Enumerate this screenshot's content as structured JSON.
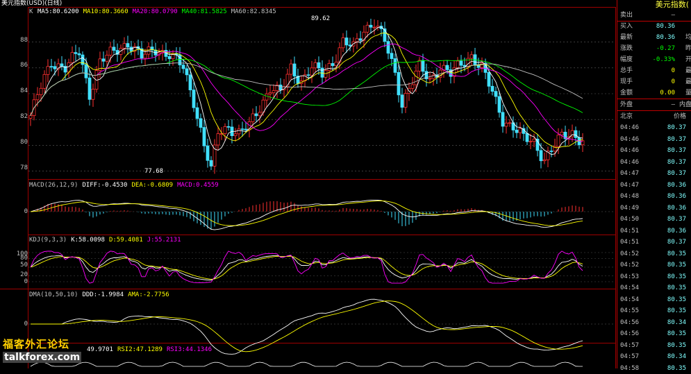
{
  "window_title": "美元指数(USD)(日线)",
  "main": {
    "legend_lead": "K",
    "legend": [
      {
        "label": "MA5:80.6200",
        "color": "#ffffff"
      },
      {
        "label": "MA10:80.3660",
        "color": "#ffff00"
      },
      {
        "label": "MA20:80.0790",
        "color": "#ff00ff"
      },
      {
        "label": "MA40:81.5825",
        "color": "#00ff00"
      },
      {
        "label": "MA60:82.8345",
        "color": "#c0c0c0"
      }
    ],
    "y_ticks": [
      "88",
      "86",
      "84",
      "82",
      "80",
      "78"
    ],
    "high_label": "89.62",
    "low_label": "77.68"
  },
  "macd": {
    "legend": [
      {
        "label": "MACD(26,12,9)",
        "color": "#c0c0c0"
      },
      {
        "label": "DIFF:-0.4530",
        "color": "#ffffff"
      },
      {
        "label": "DEA:-0.6809",
        "color": "#ffff00"
      },
      {
        "label": "MACD:0.4559",
        "color": "#ff00ff"
      }
    ],
    "y_ticks": [
      "0"
    ]
  },
  "kdj": {
    "legend": [
      {
        "label": "KDJ(9,3,3)",
        "color": "#c0c0c0"
      },
      {
        "label": "K:58.0098",
        "color": "#ffffff"
      },
      {
        "label": "D:59.4081",
        "color": "#ffff00"
      },
      {
        "label": "J:55.2131",
        "color": "#ff00ff"
      }
    ],
    "y_ticks": [
      "100",
      "80",
      "50",
      "20",
      "0"
    ]
  },
  "dma": {
    "legend": [
      {
        "label": "DMA(10,50,10)",
        "color": "#c0c0c0"
      },
      {
        "label": "DDD:-1.9984",
        "color": "#ffffff"
      },
      {
        "label": "AMA:-2.7756",
        "color": "#ffff00"
      }
    ],
    "y_ticks": [
      "0"
    ]
  },
  "rsi": {
    "legend": [
      {
        "label": "49.9701",
        "color": "#ffffff"
      },
      {
        "label": "RSI2:47.1289",
        "color": "#ffff00"
      },
      {
        "label": "RSI3:44.1346",
        "color": "#ff00ff"
      }
    ]
  },
  "panel": {
    "title": "美元指数(",
    "quote_rows": [
      {
        "key": "卖出",
        "value": "—",
        "extra": "",
        "color": "#c0c0c0"
      },
      {
        "key": "买入",
        "value": "80.36",
        "extra": "",
        "color": "#80ffff"
      },
      {
        "key": "最新",
        "value": "80.36",
        "extra": "均",
        "color": "#80ffff"
      },
      {
        "key": "涨跌",
        "value": "-0.27",
        "extra": "昨",
        "color": "#00ff00"
      },
      {
        "key": "幅度",
        "value": "-0.33%",
        "extra": "开",
        "color": "#00ff00"
      },
      {
        "key": "总手",
        "value": "0",
        "extra": "最",
        "color": "#ffff00"
      },
      {
        "key": "现手",
        "value": "0",
        "extra": "最",
        "color": "#ffff00"
      },
      {
        "key": "金额",
        "value": "0.00",
        "extra": "量",
        "color": "#ffff00"
      }
    ],
    "trade_row": {
      "key": "外盘",
      "value": "—",
      "extra": "内盘"
    },
    "ticks_header": {
      "time": "北京",
      "price": "价格"
    },
    "ticks": [
      {
        "time": "04:46",
        "price": "80.37"
      },
      {
        "time": "04:46",
        "price": "80.37"
      },
      {
        "time": "04:46",
        "price": "80.37"
      },
      {
        "time": "04:46",
        "price": "80.37"
      },
      {
        "time": "04:47",
        "price": "80.37"
      },
      {
        "time": "04:47",
        "price": "80.36"
      },
      {
        "time": "04:48",
        "price": "80.36"
      },
      {
        "time": "04:49",
        "price": "80.36"
      },
      {
        "time": "04:50",
        "price": "80.37"
      },
      {
        "time": "04:51",
        "price": "80.36"
      },
      {
        "time": "04:51",
        "price": "80.37"
      },
      {
        "time": "04:52",
        "price": "80.35"
      },
      {
        "time": "04:52",
        "price": "80.35"
      },
      {
        "time": "04:53",
        "price": "80.35"
      },
      {
        "time": "04:54",
        "price": "80.35"
      },
      {
        "time": "04:54",
        "price": "80.35"
      },
      {
        "time": "04:55",
        "price": "80.35"
      },
      {
        "time": "04:56",
        "price": "80.34"
      },
      {
        "time": "04:56",
        "price": "80.35"
      },
      {
        "time": "04:57",
        "price": "80.35"
      },
      {
        "time": "04:57",
        "price": "80.34"
      },
      {
        "time": "04:58",
        "price": "80.35"
      }
    ]
  },
  "watermark": {
    "cn": "福客外汇论坛",
    "en": "talkforex.com"
  },
  "chart_data": {
    "type": "line",
    "y_range_main": [
      77.5,
      90.5
    ],
    "close_keypoints": [
      [
        0,
        82.3
      ],
      [
        3,
        84.5
      ],
      [
        6,
        86.5
      ],
      [
        10,
        86.0
      ],
      [
        14,
        87.2
      ],
      [
        17,
        84.0
      ],
      [
        20,
        86.5
      ],
      [
        24,
        87.2
      ],
      [
        28,
        88.0
      ],
      [
        32,
        86.8
      ],
      [
        36,
        87.5
      ],
      [
        40,
        87.0
      ],
      [
        44,
        86.0
      ],
      [
        47,
        83.5
      ],
      [
        50,
        80.0
      ],
      [
        52,
        78.0
      ],
      [
        54,
        81.0
      ],
      [
        57,
        81.5
      ],
      [
        60,
        80.9
      ],
      [
        63,
        81.5
      ],
      [
        66,
        83.0
      ],
      [
        69,
        84.5
      ],
      [
        72,
        84.0
      ],
      [
        75,
        86.0
      ],
      [
        78,
        85.0
      ],
      [
        81,
        86.0
      ],
      [
        84,
        85.5
      ],
      [
        87,
        86.5
      ],
      [
        90,
        88.0
      ],
      [
        93,
        87.5
      ],
      [
        96,
        89.0
      ],
      [
        99,
        89.6
      ],
      [
        102,
        88.0
      ],
      [
        105,
        85.5
      ],
      [
        107,
        83.3
      ],
      [
        109,
        84.5
      ],
      [
        112,
        86.0
      ],
      [
        115,
        85.0
      ],
      [
        118,
        86.2
      ],
      [
        121,
        85.5
      ],
      [
        124,
        86.2
      ],
      [
        127,
        87.0
      ],
      [
        130,
        86.0
      ],
      [
        133,
        84.0
      ],
      [
        136,
        82.0
      ],
      [
        139,
        81.5
      ],
      [
        142,
        80.5
      ],
      [
        145,
        80.2
      ],
      [
        148,
        79.0
      ],
      [
        151,
        80.0
      ],
      [
        153,
        80.6
      ],
      [
        156,
        81.0
      ],
      [
        159,
        80.4
      ]
    ],
    "ma_series": [
      {
        "name": "MA5",
        "window": 5,
        "color": "#ffffff"
      },
      {
        "name": "MA10",
        "window": 10,
        "color": "#ffff00"
      },
      {
        "name": "MA20",
        "window": 20,
        "color": "#ff00ff"
      },
      {
        "name": "MA40",
        "window": 40,
        "color": "#00ff00"
      },
      {
        "name": "MA60",
        "window": 60,
        "color": "#c0c0c0"
      }
    ]
  }
}
